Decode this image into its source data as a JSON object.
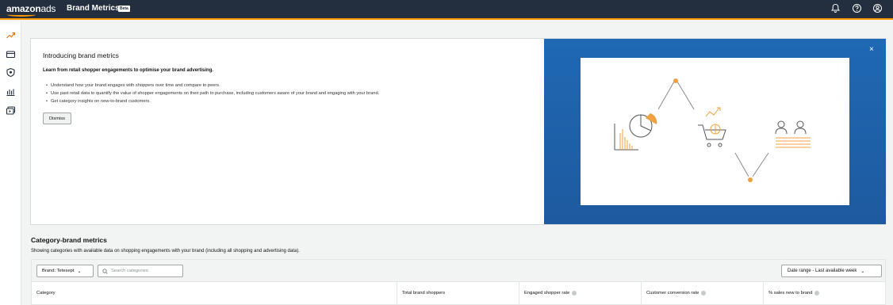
{
  "header": {
    "logo_main": "amazon",
    "logo_sub": "ads",
    "app_title": "Brand Metrics",
    "beta_badge": "Beta",
    "icons": [
      "bell-icon",
      "help-icon",
      "account-icon"
    ]
  },
  "sidebar": {
    "items": [
      {
        "icon": "trend-icon",
        "active": true
      },
      {
        "icon": "billing-icon"
      },
      {
        "icon": "shield-icon"
      },
      {
        "icon": "bar-chart-icon"
      },
      {
        "icon": "media-icon"
      }
    ]
  },
  "banner": {
    "title": "Introducing brand metrics",
    "subtitle": "Learn from retail shopper engagements to optimise your brand advertising.",
    "bullets": [
      "Understand how your brand engages with shoppers over time and compare to peers.",
      "Use past retail data to quantify the value of shopper engagements on their path to purchase, including customers aware of your brand and engaging with your brand.",
      "Get category insights on new-to-brand customers."
    ],
    "dismiss_label": "Dismiss",
    "close_label": "×"
  },
  "section": {
    "title": "Category-brand metrics",
    "description": "Showing categories with available data on shopping engagements with your brand (including all shopping and advertising data)."
  },
  "toolbar": {
    "brand_label": "Brand: Tetesept",
    "search_placeholder": "Search categories",
    "date_range_label": "Date range - Last available week"
  },
  "table": {
    "columns": [
      {
        "label": "Category",
        "info": false
      },
      {
        "label": "Total brand shoppers",
        "info": false
      },
      {
        "label": "Engaged shopper rate",
        "info": true
      },
      {
        "label": "Customer conversion rate",
        "info": true
      },
      {
        "label": "% sales new to brand",
        "info": true
      }
    ]
  },
  "colors": {
    "topbar": "#232f3e",
    "accent": "#ff9900",
    "hero_blue": "#1f68b3"
  }
}
